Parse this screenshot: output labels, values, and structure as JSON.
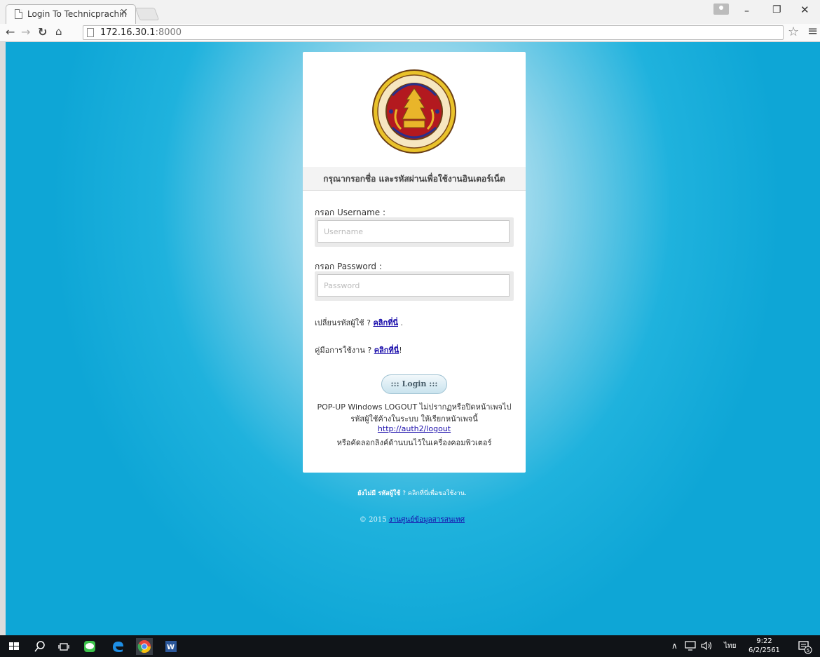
{
  "browser": {
    "tab_title": "Login To Technicprachin",
    "tab_close": "✕",
    "url_host": "172.16.30.1",
    "url_port": ":8000"
  },
  "login": {
    "heading": "กรุณากรอกชื่อ และรหัสผ่านเพื่อใช้งานอินเตอร์เน็ต",
    "username_label": "กรอก Username :",
    "username_placeholder": "Username",
    "password_label": "กรอก Password :",
    "password_placeholder": "Password",
    "change_password_text": "เปลี่ยนรหัสผู้ใช้ ? ",
    "change_password_link": "คลิกที่นี่",
    "change_password_end": " .",
    "manual_text": "คู่มือการใช้งาน ? ",
    "manual_link": "คลิกที่นี่",
    "manual_end": "!",
    "login_button": "::: Login :::",
    "note_line1": "POP-UP Windows LOGOUT ไม่ปรากฏหรือปิดหน้าเพจไป",
    "note_line2": "รหัสผู้ใช้ค้างในระบบ ให้เรียกหน้าเพจนี้",
    "note_link": "http://auth2/logout",
    "note_line3": "หรือคัดลอกลิงค์ด้านบนไว้ในเครื่องคอมพิวเตอร์"
  },
  "footer": {
    "register_bold": "ยังไม่มี รหัสผู้ใช้",
    "register_rest": " ? คลิกที่นี่เพื่อขอใช้งาน.",
    "copyright": "© 2015 ",
    "copyright_link": "งานศูนย์ข้อมูลสารสนเทศ"
  },
  "taskbar": {
    "language": "ไทย",
    "time": "9:22",
    "date": "6/2/2561",
    "notification_count": "5"
  },
  "colors": {
    "page_background": "#1fb2dd",
    "taskbar": "#101317",
    "link": "#1a0dab"
  },
  "logo": {
    "text_arc_top": "วิทยาลัยเทคนิคปราจีนบุรี",
    "text_arc_bottom": "PRACHINBURI TECHNICAL COLLEGE"
  }
}
